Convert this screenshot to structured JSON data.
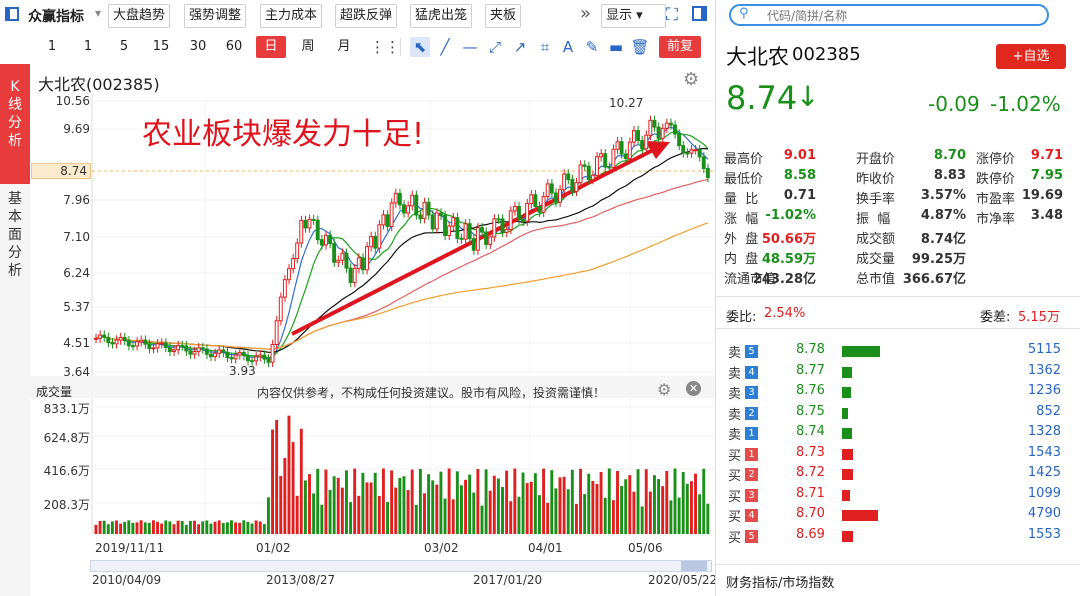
{
  "top_bar": {
    "indicators_label": "众赢指标",
    "tabs": [
      "大盘趋势",
      "强势调整",
      "主力成本",
      "超跌反弹",
      "猛虎出笼",
      "夹板"
    ],
    "display_label": "显示",
    "search_placeholder": "代码/简拼/名称"
  },
  "toolbar": {
    "periods": [
      "1",
      "1",
      "5",
      "15",
      "30",
      "60",
      "日",
      "周",
      "月"
    ],
    "active_period": "日",
    "adjust_label": "前复"
  },
  "side_tabs": {
    "kline": "K线分析",
    "fundamental": "基本面分析"
  },
  "chart": {
    "title": "大北农(002385)",
    "annotation": "农业板块爆发力十足!",
    "current_price_label": "8.74",
    "y_ticks": [
      "10.56",
      "9.69",
      "7.96",
      "7.10",
      "6.24",
      "5.37",
      "4.51",
      "3.64"
    ],
    "high_marker": "10.27",
    "low_marker": "3.93",
    "volume_title": "成交量",
    "disclaimer": "内容仅供参考，不构成任何投资建议。股市有风险，投资需谨慎！",
    "volume_ticks": [
      "833.1万",
      "624.8万",
      "416.6万",
      "208.3万"
    ],
    "x_ticks": [
      "2019/11/11",
      "01/02",
      "03/02",
      "04/01",
      "05/06"
    ],
    "range_ticks": [
      "2010/04/09",
      "2013/08/27",
      "2017/01/20",
      "2020/05/22"
    ]
  },
  "quote": {
    "name": "大北农",
    "code": "002385",
    "add_watch": "+自选",
    "price": "8.74",
    "arrow": "↓",
    "change": "-0.09",
    "change_pct": "-1.02%",
    "grid": [
      [
        {
          "k": "最高价",
          "v": "9.01",
          "c": "red"
        },
        {
          "k": "开盘价",
          "v": "8.70",
          "c": "green"
        },
        {
          "k": "涨停价",
          "v": "9.71",
          "c": "red"
        }
      ],
      [
        {
          "k": "最低价",
          "v": "8.58",
          "c": "green"
        },
        {
          "k": "昨收价",
          "v": "8.83",
          "c": "dark"
        },
        {
          "k": "跌停价",
          "v": "7.95",
          "c": "green"
        }
      ],
      [
        {
          "k": "量  比",
          "v": "0.71",
          "c": "dark"
        },
        {
          "k": "换手率",
          "v": "3.57%",
          "c": "dark"
        },
        {
          "k": "市盈率",
          "v": "19.69",
          "c": "dark"
        }
      ],
      [
        {
          "k": "涨  幅",
          "v": "-1.02%",
          "c": "green"
        },
        {
          "k": "振  幅",
          "v": "4.87%",
          "c": "dark"
        },
        {
          "k": "市净率",
          "v": "3.48",
          "c": "dark"
        }
      ],
      [
        {
          "k": "外  盘",
          "v": "50.66万",
          "c": "red"
        },
        {
          "k": "成交额",
          "v": "8.74亿",
          "c": "dark"
        },
        {
          "k": "",
          "v": "",
          "c": "dark"
        }
      ],
      [
        {
          "k": "内  盘",
          "v": "48.59万",
          "c": "green"
        },
        {
          "k": "成交量",
          "v": "99.25万",
          "c": "dark"
        },
        {
          "k": "",
          "v": "",
          "c": "dark"
        }
      ],
      [
        {
          "k": "流通市值",
          "v": "243.28亿",
          "c": "dark"
        },
        {
          "k": "总市值",
          "v": "366.67亿",
          "c": "dark"
        },
        {
          "k": "",
          "v": "",
          "c": "dark"
        }
      ]
    ],
    "weibi_label": "委比:",
    "weibi_value": "2.54%",
    "weicha_label": "委差:",
    "weicha_value": "5.15万",
    "asks": [
      {
        "side": "卖",
        "level": "5",
        "price": "8.78",
        "volume": "5115",
        "bar": 1.0
      },
      {
        "side": "卖",
        "level": "4",
        "price": "8.77",
        "volume": "1362",
        "bar": 0.27
      },
      {
        "side": "卖",
        "level": "3",
        "price": "8.76",
        "volume": "1236",
        "bar": 0.24
      },
      {
        "side": "卖",
        "level": "2",
        "price": "8.75",
        "volume": "852",
        "bar": 0.17
      },
      {
        "side": "卖",
        "level": "1",
        "price": "8.74",
        "volume": "1328",
        "bar": 0.26
      }
    ],
    "bids": [
      {
        "side": "买",
        "level": "1",
        "price": "8.73",
        "volume": "1543",
        "bar": 0.3
      },
      {
        "side": "买",
        "level": "2",
        "price": "8.72",
        "volume": "1425",
        "bar": 0.28
      },
      {
        "side": "买",
        "level": "3",
        "price": "8.71",
        "volume": "1099",
        "bar": 0.21
      },
      {
        "side": "买",
        "level": "4",
        "price": "8.70",
        "volume": "4790",
        "bar": 0.94
      },
      {
        "side": "买",
        "level": "5",
        "price": "8.69",
        "volume": "1553",
        "bar": 0.3
      }
    ],
    "footer": "财务指标/市场指数"
  },
  "colors": {
    "up": "#e02020",
    "down": "#1a8f1a",
    "accent": "#2866c6",
    "tab_red": "#e83c3c"
  }
}
